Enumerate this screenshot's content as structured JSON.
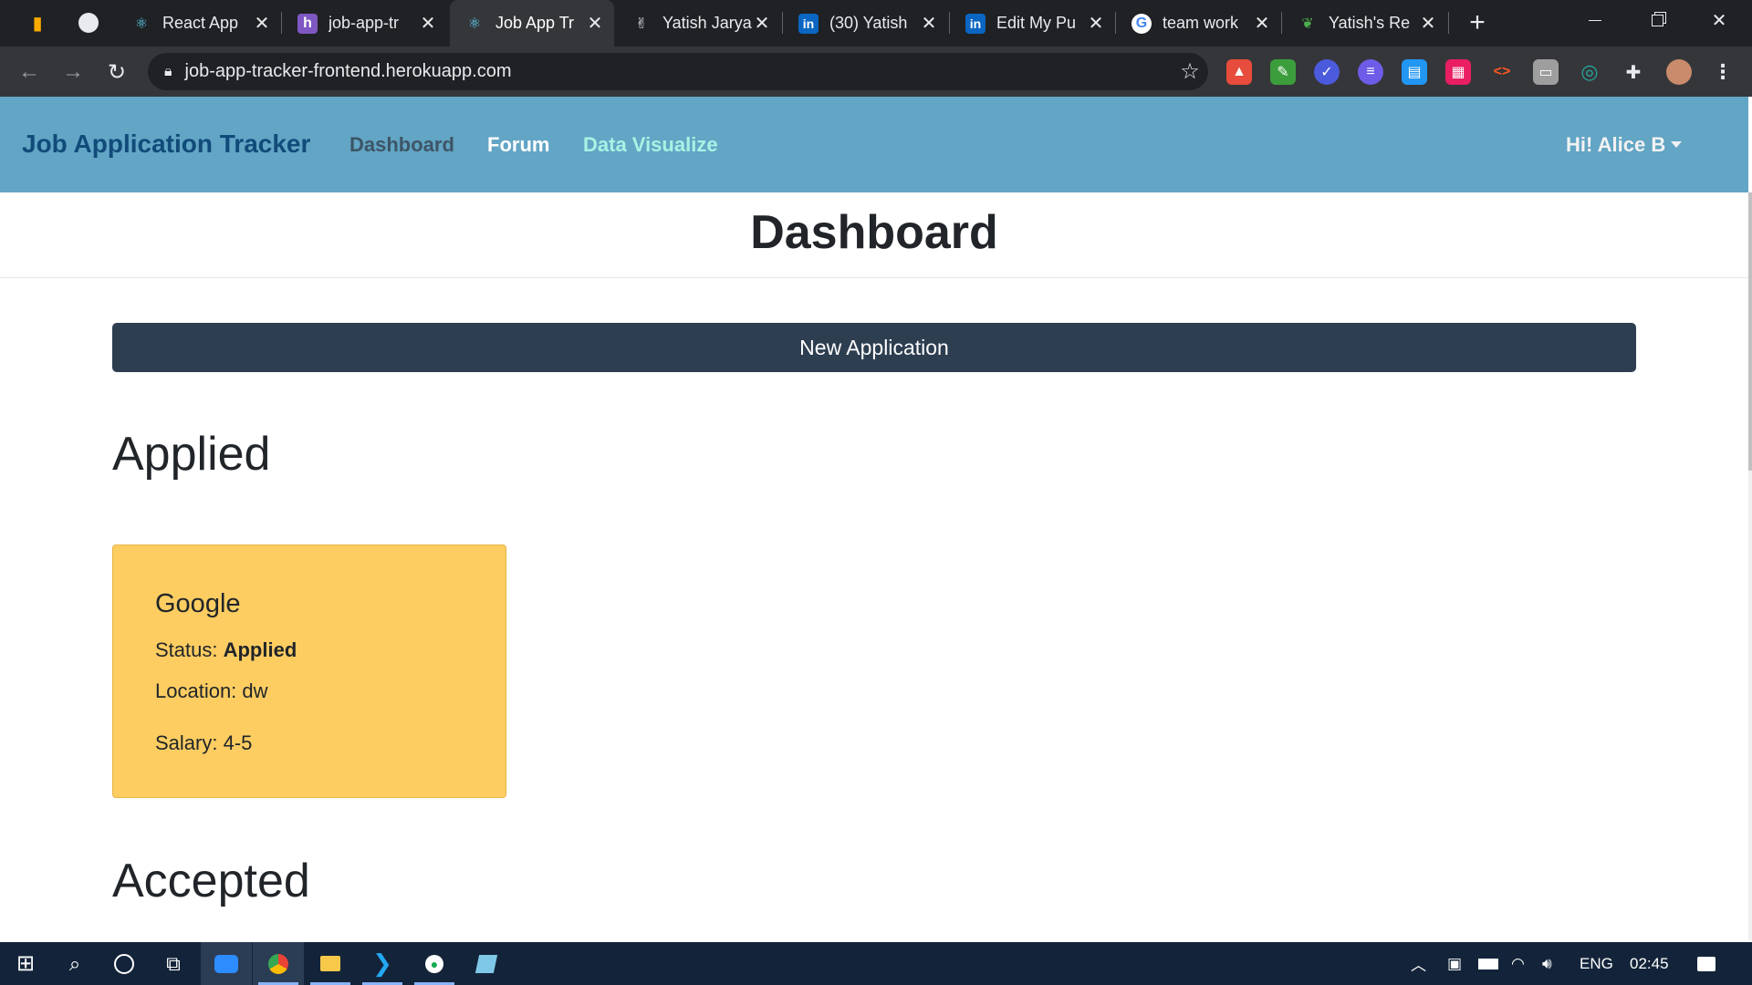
{
  "browser": {
    "tabs": [
      {
        "title": "React App",
        "icon": "react-icon"
      },
      {
        "title": "job-app-tr",
        "icon": "heroku-icon"
      },
      {
        "title": "Job App Tr",
        "icon": "react-icon",
        "active": true
      },
      {
        "title": "Yatish Jarya",
        "icon": "victory-hand-icon"
      },
      {
        "title": "(30) Yatish",
        "icon": "linkedin-icon"
      },
      {
        "title": "Edit My Pu",
        "icon": "linkedin-icon"
      },
      {
        "title": "team work",
        "icon": "google-icon"
      },
      {
        "title": "Yatish's Re",
        "icon": "leaf-icon"
      }
    ],
    "url": "job-app-tracker-frontend.herokuapp.com"
  },
  "app": {
    "brand": "Job Application Tracker",
    "nav": {
      "dashboard": "Dashboard",
      "forum": "Forum",
      "data_visualize": "Data Visualize"
    },
    "user_greeting": "Hi! Alice B",
    "colors": {
      "navbar": "#62a5c5",
      "brand": "#114b7a",
      "dashboard_link": "#3d5566",
      "forum_link": "#ffffff",
      "data_visualize_link": "#a6f3e4",
      "button": "#2d3e50",
      "card": "#fdcd62"
    }
  },
  "main": {
    "page_title": "Dashboard",
    "new_application_label": "New Application",
    "sections": {
      "applied": "Applied",
      "accepted": "Accepted"
    },
    "card": {
      "company": "Google",
      "status_label": "Status:",
      "status_value": "Applied",
      "location_text": "Location: dw",
      "salary_text": "Salary: 4-5"
    }
  },
  "taskbar": {
    "language": "ENG",
    "time": "02:45"
  }
}
